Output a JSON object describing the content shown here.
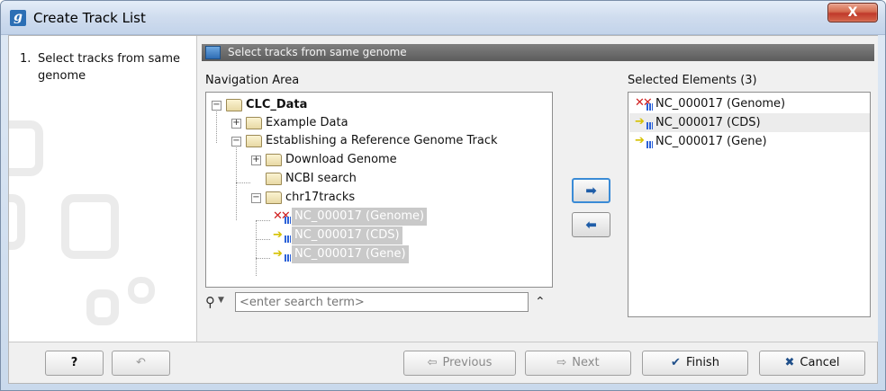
{
  "window": {
    "title": "Create Track List",
    "app_icon_letter": "g",
    "close_glyph": "X"
  },
  "steps": [
    {
      "number": "1.",
      "label": "Select tracks from same genome"
    }
  ],
  "panel": {
    "header": "Select tracks from same genome",
    "nav_label": "Navigation Area",
    "selected_label": "Selected Elements (3)"
  },
  "tree": {
    "root": "CLC_Data",
    "example_data": "Example Data",
    "establishing": "Establishing a Reference Genome Track",
    "download_genome": "Download Genome",
    "ncbi_search": "NCBI search",
    "chr17tracks": "chr17tracks",
    "track_genome": "NC_000017 (Genome)",
    "track_cds": "NC_000017 (CDS)",
    "track_gene": "NC_000017 (Gene)"
  },
  "search": {
    "placeholder": "<enter search term>",
    "icon": "search-icon"
  },
  "transfer": {
    "add_glyph": "➡",
    "remove_glyph": "⬅"
  },
  "selected": [
    {
      "label": "NC_000017 (Genome)",
      "icon": "genome-track-icon"
    },
    {
      "label": "NC_000017 (CDS)",
      "icon": "annotation-track-icon"
    },
    {
      "label": "NC_000017 (Gene)",
      "icon": "annotation-track-icon"
    }
  ],
  "footer": {
    "help": "?",
    "previous": "Previous",
    "next": "Next",
    "finish": "Finish",
    "cancel": "Cancel"
  },
  "colors": {
    "accent": "#2f6db4",
    "header_bar": "#6e6e6e",
    "selection": "#c9c9c9"
  }
}
